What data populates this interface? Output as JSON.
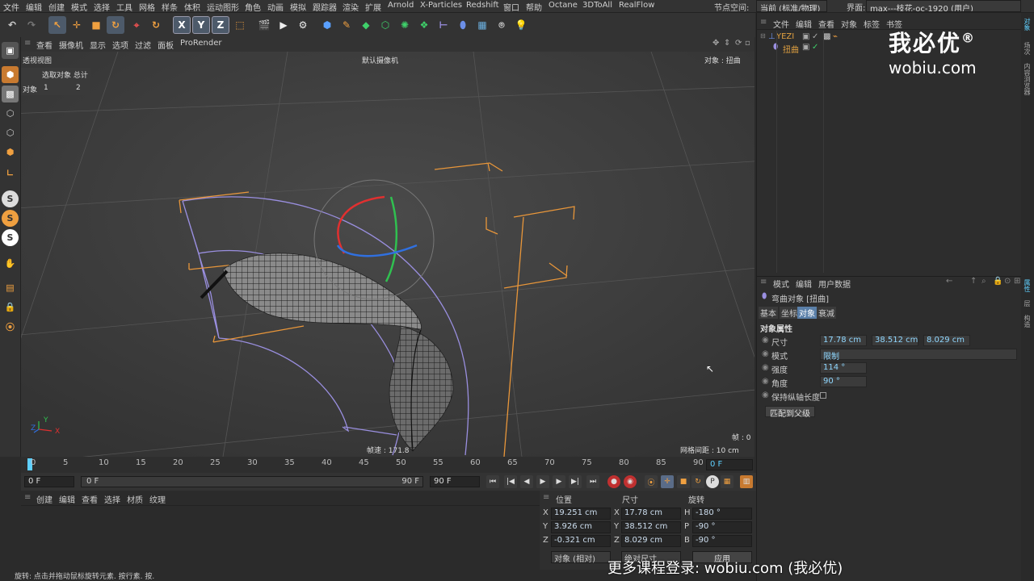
{
  "menubar": {
    "items": [
      "文件",
      "编辑",
      "创建",
      "模式",
      "选择",
      "工具",
      "网格",
      "样条",
      "体积",
      "运动图形",
      "角色",
      "动画",
      "模拟",
      "跟踪器",
      "渲染",
      "扩展",
      "Arnold",
      "X-Particles",
      "Redshift",
      "窗口",
      "帮助",
      "Octane",
      "3DToAll",
      "RealFlow"
    ],
    "node_space_label": "节点空间:",
    "node_space_value": "当前 (标准/物理)",
    "interface_label": "界面:",
    "interface_value": "max---枝花-oc-1920 (用户)"
  },
  "toolbar": {
    "axis_x": "X",
    "axis_y": "Y",
    "axis_z": "Z"
  },
  "viewport_menu": {
    "items": [
      "查看",
      "摄像机",
      "显示",
      "选项",
      "过滤",
      "面板",
      "ProRender"
    ]
  },
  "viewport": {
    "view_name": "透视视图",
    "camera": "默认摄像机",
    "object_label": "对象 : 扭曲",
    "stats_header": "选取对象 总计",
    "stats_row_label": "对象",
    "stats_selected": "1",
    "stats_total": "2",
    "frame_rate": "帧速 : 171.8",
    "frame": "帧 : 0",
    "grid_spacing": "网格间距 : 10 cm",
    "axis_x": "X",
    "axis_y": "Y",
    "axis_z": "Z"
  },
  "timeline": {
    "ticks": [
      "0",
      "5",
      "10",
      "15",
      "20",
      "25",
      "30",
      "35",
      "40",
      "45",
      "50",
      "55",
      "60",
      "65",
      "70",
      "75",
      "80",
      "85",
      "90"
    ],
    "current_frame": "0 F"
  },
  "transport": {
    "start": "0 F",
    "range_start": "0 F",
    "range_end": "90 F",
    "end": "90 F",
    "p_label": "P"
  },
  "material_panel": {
    "menu": [
      "创建",
      "编辑",
      "查看",
      "选择",
      "材质",
      "纹理"
    ]
  },
  "coord_panel": {
    "headers": [
      "位置",
      "尺寸",
      "旋转"
    ],
    "rows": [
      {
        "axis": "X",
        "pos": "19.251 cm",
        "size_axis": "X",
        "size": "17.78 cm",
        "rot_axis": "H",
        "rot": "-180 °"
      },
      {
        "axis": "Y",
        "pos": "3.926 cm",
        "size_axis": "Y",
        "size": "38.512 cm",
        "rot_axis": "P",
        "rot": "-90 °"
      },
      {
        "axis": "Z",
        "pos": "-0.321 cm",
        "size_axis": "Z",
        "size": "8.029 cm",
        "rot_axis": "B",
        "rot": "-90 °"
      }
    ],
    "mode_select": "对象 (相对)",
    "size_select": "绝对尺寸",
    "apply_button": "应用"
  },
  "object_manager": {
    "menu": [
      "文件",
      "编辑",
      "查看",
      "对象",
      "标签",
      "书签"
    ],
    "objects": [
      {
        "name": "YEZI",
        "color": "#e0a040"
      },
      {
        "name": "扭曲",
        "color": "#e0a040"
      }
    ]
  },
  "attributes": {
    "menu": [
      "模式",
      "编辑",
      "用户数据"
    ],
    "object_title": "弯曲对象 [扭曲]",
    "tabs": [
      "基本",
      "坐标",
      "对象",
      "衰减"
    ],
    "active_tab": "对象",
    "section_title": "对象属性",
    "size_label": "尺寸",
    "size_x": "17.78 cm",
    "size_y": "38.512 cm",
    "size_z": "8.029 cm",
    "mode_label": "模式",
    "mode_value": "限制",
    "strength_label": "强度",
    "strength_value": "114 °",
    "angle_label": "角度",
    "angle_value": "90 °",
    "keep_length_label": "保持纵轴长度",
    "fit_parent_button": "匹配到父级"
  },
  "right_sidebar": {
    "tabs": [
      "对象",
      "场次",
      "内容浏览器",
      "属性",
      "层",
      "构造"
    ]
  },
  "status_bar": {
    "text": "旋转: 点击并拖动鼠标旋转元素. 按行素. 按."
  },
  "watermark": {
    "brand": "我必优",
    "registered": "®",
    "url": "wobiu.com"
  },
  "promo_text": "更多课程登录: wobiu.com (我必优)",
  "colors": {
    "accent_cyan": "#5fd0ff",
    "selection_orange": "#e8963a",
    "deformer_purple": "#9a8fe0"
  }
}
